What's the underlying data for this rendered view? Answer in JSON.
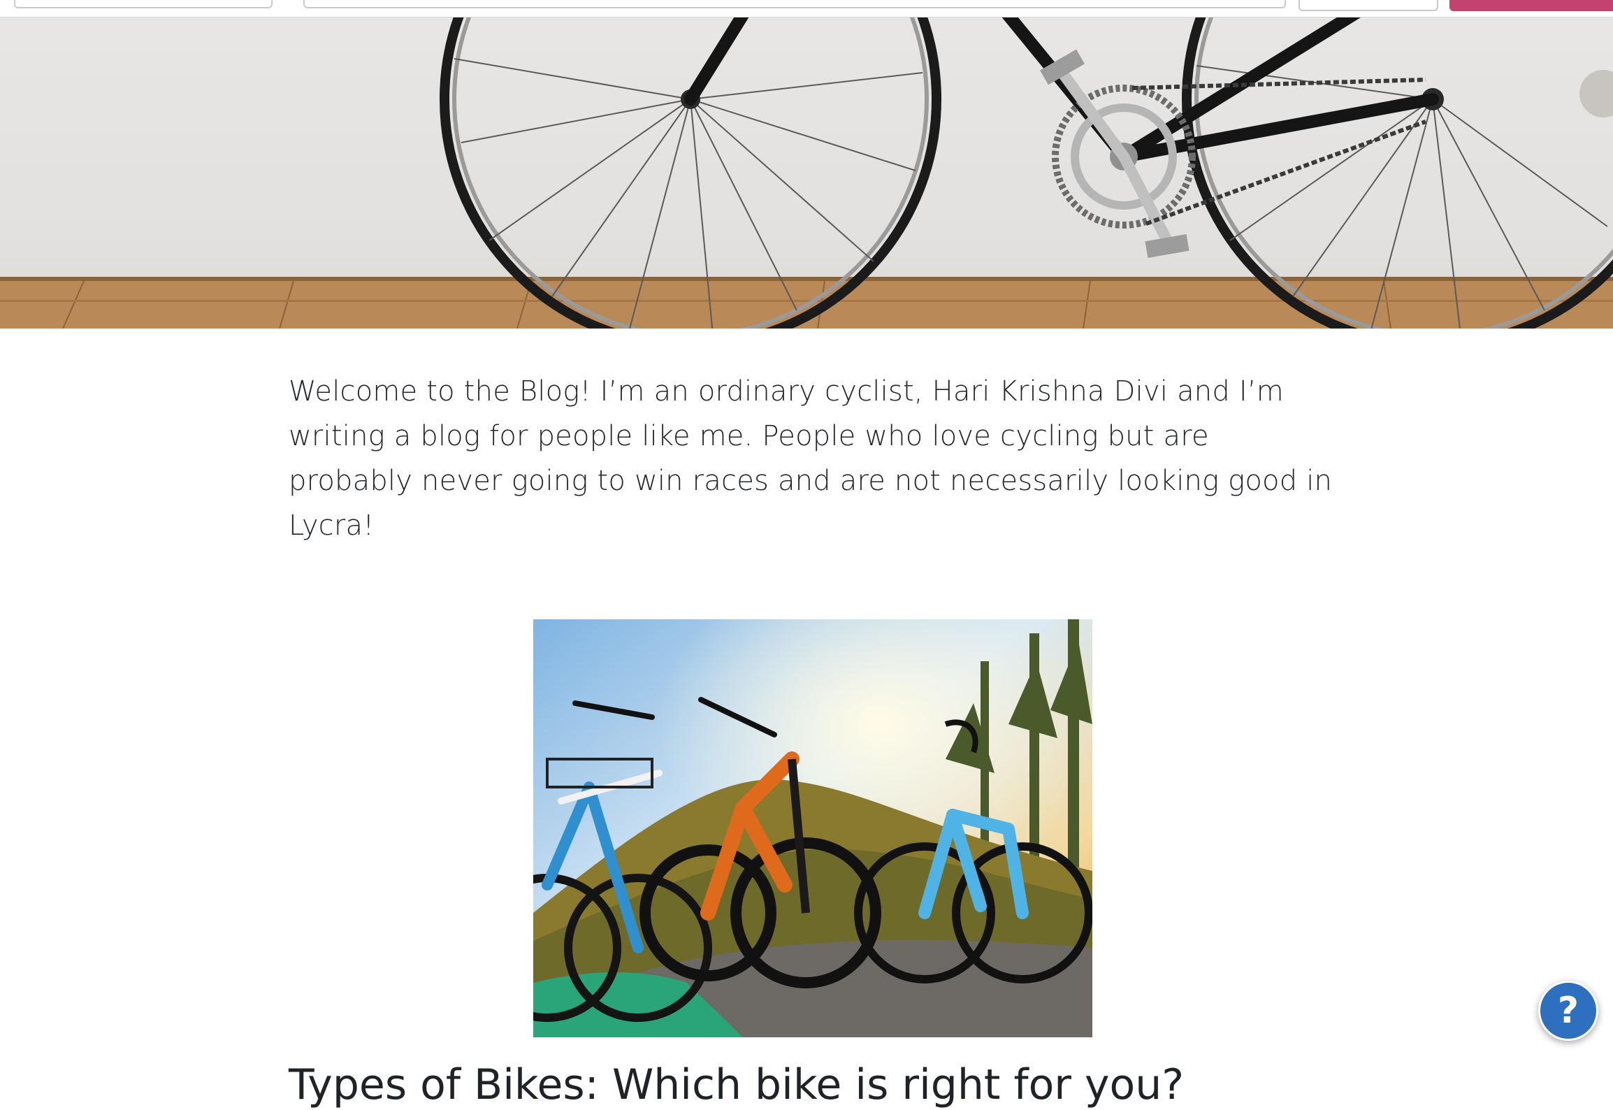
{
  "header": {
    "search_field": "",
    "main_field": "",
    "secondary_button": "",
    "primary_button": "",
    "accent_color": "#c4426f"
  },
  "hero": {
    "image_subject": "road bicycle leaning against white wall on wooden floor"
  },
  "intro": {
    "text": "Welcome to the Blog! I’m an ordinary cyclist, Hari Krishna Divi and I’m writing a blog for people like me. People who love cycling but are probably never going to win races and are not necessarily looking good in Lycra!"
  },
  "featured_post": {
    "image_subject": "three bikes: cargo e-bike, orange mountain bike, blue gravel bike on a forest trail",
    "heading": "Types of Bikes: Which bike is right for you?"
  },
  "help_button": {
    "label": "?",
    "color": "#2f6fbf"
  }
}
